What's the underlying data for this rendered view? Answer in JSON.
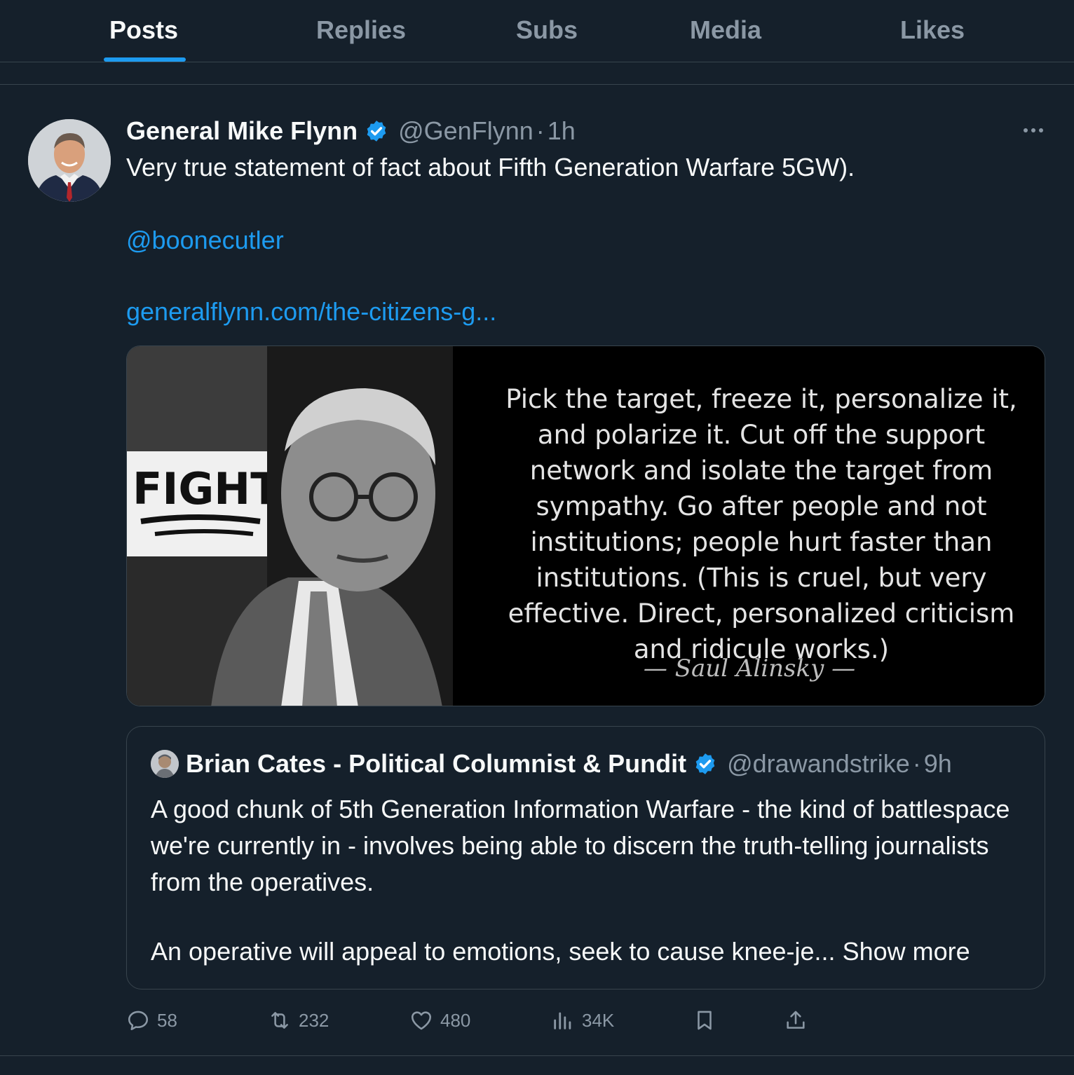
{
  "tabs": [
    {
      "label": "Posts",
      "active": true
    },
    {
      "label": "Replies",
      "active": false
    },
    {
      "label": "Subs",
      "active": false
    },
    {
      "label": "Media",
      "active": false
    },
    {
      "label": "Likes",
      "active": false
    }
  ],
  "post": {
    "author_name": "General Mike Flynn",
    "handle": "@GenFlynn",
    "separator": "·",
    "time": "1h",
    "text": "Very true statement of fact about Fifth Generation Warfare 5GW).",
    "mention": "@boonecutler",
    "link": "generalflynn.com/the-citizens-g...",
    "media_quote": "Pick the target, freeze it, personalize it, and polarize it. Cut off the support network and isolate the target from sympathy. Go after people and not institutions; people hurt faster than institutions. (This is cruel, but very effective. Direct, personalized criticism and ridicule works.)",
    "media_attribution": "— Saul Alinsky —",
    "media_sign": "FIGHT"
  },
  "quoted": {
    "author_name": "Brian Cates - Political Columnist & Pundit",
    "handle": "@drawandstrike",
    "separator": "·",
    "time": "9h",
    "paragraph1": "A good chunk of 5th Generation Information Warfare - the kind of battlespace we're currently in - involves being able to discern the truth-telling journalists from the operatives.",
    "paragraph2": "An operative will appeal to emotions, seek to cause knee-je...",
    "show_more": "Show more"
  },
  "actions": {
    "replies": "58",
    "reposts": "232",
    "likes": "480",
    "views": "34K"
  },
  "colors": {
    "background": "#15202b",
    "accent": "#1d9bf0",
    "muted": "#8b98a5",
    "border": "#38444d"
  },
  "icons": [
    "verified-badge-icon",
    "more-icon",
    "reply-icon",
    "repost-icon",
    "like-icon",
    "views-icon",
    "bookmark-icon",
    "share-icon"
  ]
}
